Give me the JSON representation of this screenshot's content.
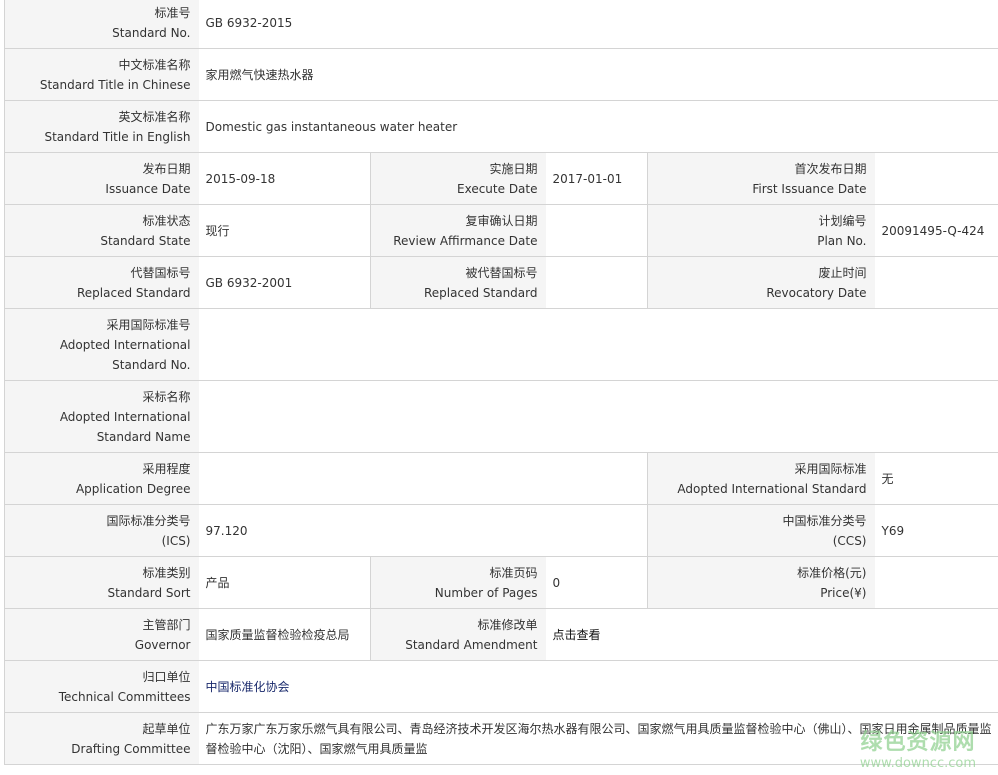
{
  "rows": {
    "std_no": {
      "cn": "标准号",
      "en": "Standard No.",
      "value": "GB 6932-2015"
    },
    "title_cn": {
      "cn": "中文标准名称",
      "en": "Standard Title in Chinese",
      "value": "家用燃气快速热水器"
    },
    "title_en": {
      "cn": "英文标准名称",
      "en": "Standard Title in English",
      "value": "Domestic gas instantaneous water heater"
    },
    "issuance": {
      "cn": "发布日期",
      "en": "Issuance Date",
      "value": "2015-09-18"
    },
    "execute": {
      "cn": "实施日期",
      "en": "Execute Date",
      "value": "2017-01-01"
    },
    "first_issuance": {
      "cn": "首次发布日期",
      "en": "First Issuance Date",
      "value": ""
    },
    "state": {
      "cn": "标准状态",
      "en": "Standard State",
      "value": "现行"
    },
    "review": {
      "cn": "复审确认日期",
      "en": "Review Affirmance Date",
      "value": ""
    },
    "plan": {
      "cn": "计划编号",
      "en": "Plan No.",
      "value": "20091495-Q-424"
    },
    "replaced": {
      "cn": "代替国标号",
      "en": "Replaced Standard",
      "value": "GB 6932-2001"
    },
    "replaced_by": {
      "cn": "被代替国标号",
      "en": "Replaced Standard",
      "value": ""
    },
    "revocatory": {
      "cn": "废止时间",
      "en": "Revocatory Date",
      "value": ""
    },
    "adopted_no": {
      "cn": "采用国际标准号",
      "en1": "Adopted International",
      "en2": "Standard No.",
      "value": ""
    },
    "adopted_name": {
      "cn": "采标名称",
      "en1": "Adopted International",
      "en2": "Standard Name",
      "value": ""
    },
    "app_degree": {
      "cn": "采用程度",
      "en": "Application Degree",
      "value": ""
    },
    "adopted_intl": {
      "cn": "采用国际标准",
      "en": "Adopted International Standard",
      "value": "无"
    },
    "ics": {
      "cn": "国际标准分类号",
      "en": "(ICS)",
      "value": "97.120"
    },
    "ccs": {
      "cn": "中国标准分类号",
      "en": "(CCS)",
      "value": "Y69"
    },
    "sort": {
      "cn": "标准类别",
      "en": "Standard Sort",
      "value": "产品"
    },
    "pages": {
      "cn": "标准页码",
      "en": "Number of Pages",
      "value": "0"
    },
    "price": {
      "cn": "标准价格(元)",
      "en": "Price(¥)",
      "value": ""
    },
    "governor": {
      "cn": "主管部门",
      "en": "Governor",
      "value": "国家质量监督检验检疫总局"
    },
    "amendment": {
      "cn": "标准修改单",
      "en": "Standard Amendment",
      "value": "点击查看"
    },
    "tech": {
      "cn": "归口单位",
      "en": "Technical Committees",
      "value": "中国标准化协会"
    },
    "drafting": {
      "cn": "起草单位",
      "en": "Drafting Committee",
      "value": "广东万家广东万家乐燃气具有限公司、青岛经济技术开发区海尔热水器有限公司、国家燃气用具质量监督检验中心（佛山）、国家日用金属制品质量监督检验中心（沈阳）、国家燃气用具质量监"
    }
  },
  "watermark": {
    "cn": "绿色资源网",
    "url": "www.downcc.com"
  }
}
